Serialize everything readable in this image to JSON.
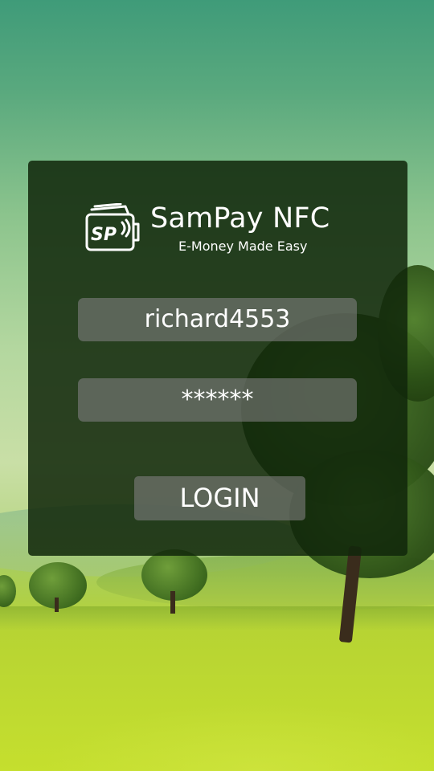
{
  "app": {
    "title": "SamPay NFC",
    "tagline": "E-Money Made Easy",
    "logo_icon": "wallet-nfc-icon",
    "logo_letters": "SP"
  },
  "login_form": {
    "username_value": "richard4553",
    "password_value": "******",
    "login_label": "LOGIN"
  },
  "colors": {
    "card_background": "#10260a",
    "field_background": "#7d7d7d",
    "text": "#ffffff"
  }
}
